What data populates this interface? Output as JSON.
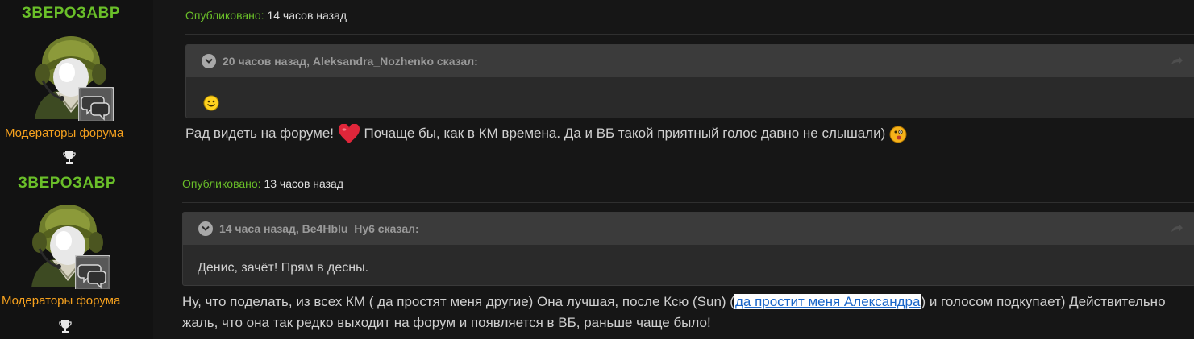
{
  "posts": [
    {
      "author": "ЗВЕРОЗАВР",
      "group": "Модераторы форума",
      "published_label": "Опубликовано:",
      "published_time": "14 часов назад",
      "quote": {
        "header": "20 часов назад, Aleksandra_Nozhenko сказал:",
        "body": ""
      },
      "text_before": "Рад видеть на форуме! ",
      "text_after": " Почаще бы, как в КМ времена. Да и ВБ такой приятный голос давно не слышали) "
    },
    {
      "author": "ЗВЕРОЗАВР",
      "group": "Модераторы форума",
      "published_label": "Опубликовано:",
      "published_time": "13 часов назад",
      "quote": {
        "header": "14 часа назад, Be4Hblu_Hy6 сказал:",
        "body": "Денис, зачёт! Прям в десны."
      },
      "line1_before": "Ну, что поделать, из всех КМ ( да простят меня другие) Она лучшая, после Ксю (Sun) (",
      "link_text": "да простит меня Александра",
      "line1_after": ") и голосом подкупает) Действительно",
      "line2": "жаль, что она так редко выходит на форум и появляется в ВБ, раньше чаще было!"
    }
  ],
  "icons": {
    "avatar": "tank-helmet-avatar-icon",
    "badge": "speech-bubbles-icon",
    "trophy": "trophy-icon",
    "toggle": "chevron-down-icon",
    "share": "share-arrow-icon",
    "smile": "smile-emoji-icon",
    "heart": "heart-emoji-icon",
    "confused": "confused-emoji-icon"
  },
  "colors": {
    "author": "#6abf29",
    "group": "#f7a21e",
    "meta_label": "#6abf29",
    "link": "#1a66c9",
    "background": "#161616"
  }
}
